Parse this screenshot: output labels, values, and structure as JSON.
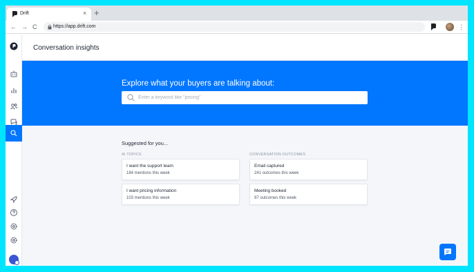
{
  "browser": {
    "tab_title": "Drift",
    "tab_close": "×",
    "new_tab": "+",
    "back": "←",
    "forward": "→",
    "reload": "C",
    "url": "https://app.drift.com",
    "menu": "⋮"
  },
  "sidebar": {
    "items": [
      {
        "icon": "bot-icon"
      },
      {
        "icon": "reports-icon"
      },
      {
        "icon": "contacts-icon"
      },
      {
        "icon": "conversations-icon"
      },
      {
        "icon": "search-icon",
        "active": true
      }
    ],
    "bottom_items": [
      {
        "icon": "rocket-icon"
      },
      {
        "icon": "help-icon"
      },
      {
        "icon": "settings-icon"
      },
      {
        "icon": "settings-icon"
      }
    ]
  },
  "page": {
    "title": "Conversation insights"
  },
  "hero": {
    "heading": "Explore what your buyers are talking about:",
    "search_placeholder": "Enter a keyword like \"pricing\""
  },
  "suggestions": {
    "title": "Suggested for you...",
    "ai_topics": {
      "label": "AI TOPICS",
      "cards": [
        {
          "title": "I want the support team",
          "subtitle": "184 mentions this week"
        },
        {
          "title": "I want pricing information",
          "subtitle": "103 mentions this week"
        }
      ]
    },
    "outcomes": {
      "label": "CONVERSATION OUTCOMES",
      "cards": [
        {
          "title": "Email captured",
          "subtitle": "241 outcomes this week"
        },
        {
          "title": "Meeting booked",
          "subtitle": "97 outcomes this week"
        }
      ]
    }
  },
  "colors": {
    "accent": "#0176ff",
    "frame": "#00e5ff"
  }
}
